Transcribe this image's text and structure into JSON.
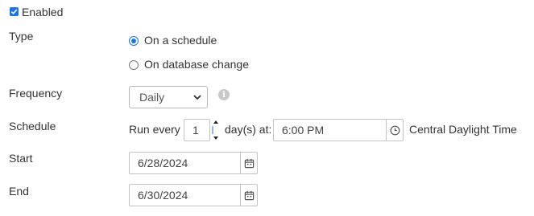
{
  "enabled": {
    "label": "Enabled",
    "checked": true
  },
  "type": {
    "label": "Type",
    "options": [
      {
        "label": "On a schedule",
        "selected": true
      },
      {
        "label": "On database change",
        "selected": false
      }
    ]
  },
  "frequency": {
    "label": "Frequency",
    "value": "Daily",
    "info_icon": "info-icon"
  },
  "schedule": {
    "label": "Schedule",
    "prefix": "Run every",
    "interval_value": "1",
    "unit_text": "day(s) at:",
    "time_value": "6:00 PM",
    "timezone": "Central Daylight Time",
    "time_icon": "clock-icon"
  },
  "start": {
    "label": "Start",
    "date": "6/28/2024",
    "icon": "calendar-icon"
  },
  "end": {
    "label": "End",
    "date": "6/30/2024",
    "icon": "calendar-icon"
  },
  "colors": {
    "accent": "#1a73e8",
    "border": "#c4c4c4",
    "text": "#333333"
  }
}
